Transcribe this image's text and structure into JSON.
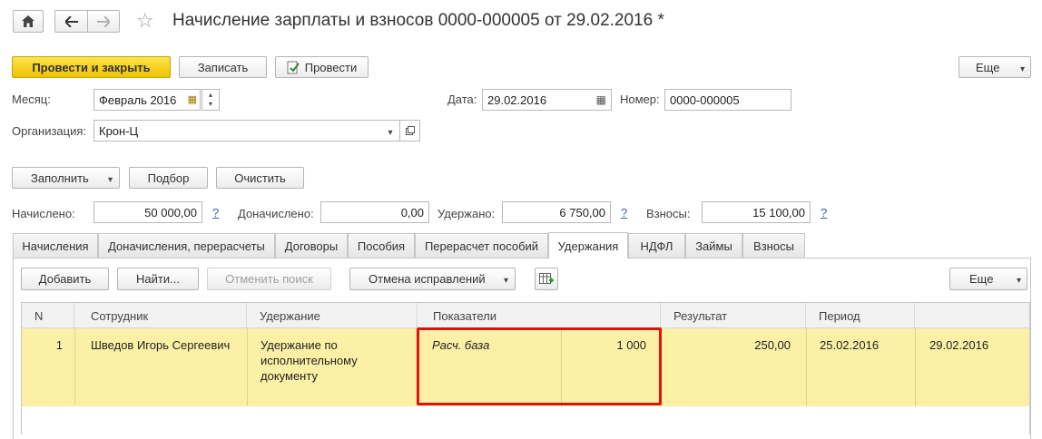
{
  "header": {
    "title": "Начисление зарплаты и взносов 0000-000005 от 29.02.2016 *"
  },
  "toolbar": {
    "post_close": "Провести и закрыть",
    "save": "Записать",
    "post": "Провести",
    "more": "Еще"
  },
  "form": {
    "month_label": "Месяц:",
    "month_value": "Февраль 2016",
    "date_label": "Дата:",
    "date_value": "29.02.2016",
    "number_label": "Номер:",
    "number_value": "0000-000005",
    "org_label": "Организация:",
    "org_value": "Крон-Ц"
  },
  "actions": {
    "fill": "Заполнить",
    "select": "Подбор",
    "clear": "Очистить"
  },
  "totals": {
    "accrued_label": "Начислено:",
    "accrued_value": "50 000,00",
    "extra_label": "Доначислено:",
    "extra_value": "0,00",
    "withheld_label": "Удержано:",
    "withheld_value": "6 750,00",
    "contrib_label": "Взносы:",
    "contrib_value": "15 100,00",
    "help": "?"
  },
  "tabs": [
    "Начисления",
    "Доначисления, перерасчеты",
    "Договоры",
    "Пособия",
    "Перерасчет пособий",
    "Удержания",
    "НДФЛ",
    "Займы",
    "Взносы"
  ],
  "table_toolbar": {
    "add": "Добавить",
    "find": "Найти...",
    "cancel_search": "Отменить поиск",
    "cancel_fix": "Отмена исправлений",
    "more": "Еще"
  },
  "table": {
    "columns": [
      "N",
      "Сотрудник",
      "Удержание",
      "Показатели",
      "Результат",
      "Период",
      ""
    ],
    "rows": [
      {
        "n": "1",
        "employee": "Шведов Игорь Сергеевич",
        "deduction_line1": "Удержание по",
        "deduction_line2": "исполнительному",
        "deduction_line3": "документу",
        "indicator_name": "Расч. база",
        "indicator_value": "1 000",
        "result": "250,00",
        "period_start": "25.02.2016",
        "period_end": "29.02.2016"
      }
    ]
  },
  "colors": {
    "primary_button": "#f5d315",
    "row_highlight": "#fbf0a6",
    "selection_box": "#e01010"
  }
}
